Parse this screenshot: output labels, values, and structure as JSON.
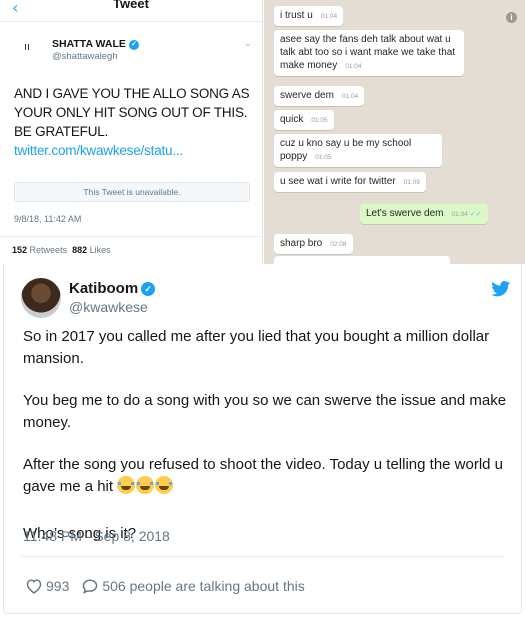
{
  "left_tweet": {
    "header_title": "Tweet",
    "author_name": "SHATTA WALE",
    "author_handle": "@shattawalegh",
    "body": "AND I GAVE YOU THE ALLO SONG AS YOUR ONLY HIT SONG OUT OF THIS. BE GRATEFUL.",
    "link": "twitter.com/kwawkese/statu...",
    "unavailable": "This Tweet is unavailable.",
    "date": "9/8/18, 11:42 AM",
    "retweets_count": "152",
    "retweets_label": "Retweets",
    "likes_count": "882",
    "likes_label": "Likes"
  },
  "chat": {
    "messages": [
      {
        "text": "i trust u",
        "time": "01:04",
        "dir": "in"
      },
      {
        "text": "asee say the fans deh talk about wat u talk abt too so i want make we take that make money",
        "time": "01:04",
        "dir": "in"
      },
      {
        "text": "swerve dem",
        "time": "01:04",
        "dir": "in"
      },
      {
        "text": "quick",
        "time": "01:05",
        "dir": "in"
      },
      {
        "text": "cuz u kno say u be my school poppy",
        "time": "01:05",
        "dir": "in"
      },
      {
        "text": "u see wat i write for twitter",
        "time": "01:09",
        "dir": "in"
      },
      {
        "text": "Let's swerve dem",
        "time": "01:34",
        "dir": "out"
      },
      {
        "text": "sharp bro",
        "time": "02:08",
        "dir": "in"
      }
    ]
  },
  "tweet": {
    "author_name": "Katiboom",
    "author_handle": "@kwawkese",
    "paragraphs": [
      "So in 2017 you called me after you lied that you bought a million dollar mansion.",
      "You beg me to do a song with you so we can swerve the issue and make money.",
      "After the song you refused to shoot the video. Today u telling the world u gave me a hit",
      "Who’s song is it?"
    ],
    "emoji": "😂😂😂",
    "timestamp": "11:48 PM - Sep 8, 2018",
    "likes": "993",
    "talking": "506 people are talking about this"
  },
  "colors": {
    "twitter_blue": "#1da1f2",
    "chat_bg": "#e4ddd4",
    "outgoing_bubble": "#dcf8c6"
  },
  "icons": [
    "back-chevron-icon",
    "verified-icon",
    "info-icon",
    "twitter-bird-icon",
    "heart-icon",
    "comment-icon",
    "read-ticks-icon"
  ]
}
